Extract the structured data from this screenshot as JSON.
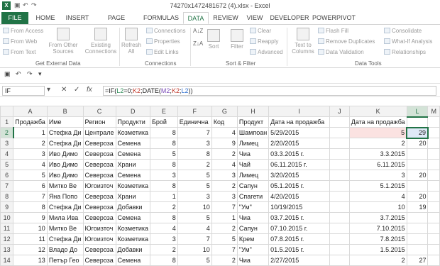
{
  "window": {
    "title": "74270x1472481672 (4).xlsx - Excel",
    "app_icon": "X"
  },
  "tabs": [
    "FILE",
    "HOME",
    "INSERT",
    "PAGE LAYOUT",
    "FORMULAS",
    "DATA",
    "REVIEW",
    "VIEW",
    "DEVELOPER",
    "POWERPIVOT"
  ],
  "ribbon": {
    "get_external": {
      "from_access": "From Access",
      "from_web": "From Web",
      "from_text": "From Text",
      "from_other": "From Other Sources",
      "existing": "Existing Connections",
      "label": "Get External Data"
    },
    "connections": {
      "refresh": "Refresh All",
      "connections": "Connections",
      "properties": "Properties",
      "edit_links": "Edit Links",
      "label": "Connections"
    },
    "sort_filter": {
      "sort": "Sort",
      "filter": "Filter",
      "clear": "Clear",
      "reapply": "Reapply",
      "advanced": "Advanced",
      "label": "Sort & Filter"
    },
    "data_tools": {
      "text_to_columns": "Text to Columns",
      "flash_fill": "Flash Fill",
      "remove_duplicates": "Remove Duplicates",
      "data_validation": "Data Validation",
      "consolidate": "Consolidate",
      "what_if": "What-If Analysis",
      "relationships": "Relationships",
      "label": "Data Tools"
    }
  },
  "namebox": "IF",
  "formula": {
    "p1": "=IF(",
    "r1": "L2",
    "p2": "=0;",
    "r2": "K2",
    "p3": ";DATE(",
    "r3": "M2",
    "p4": ";",
    "r4": "K2",
    "p5": ";",
    "r5": "L2",
    "p6": "))"
  },
  "columns": [
    "A",
    "B",
    "C",
    "D",
    "E",
    "F",
    "G",
    "H",
    "I",
    "J",
    "K",
    "L",
    "M"
  ],
  "rows": [
    [
      "Продажба",
      "Име",
      "Регион",
      "Продукти",
      "Брой",
      "Единична",
      "Код",
      "Продукт",
      "Дата на продажба",
      "",
      "Дата на продажба",
      "",
      ""
    ],
    [
      "1",
      "Стефка Ди",
      "Централе",
      "Козметика",
      "8",
      "7",
      "4",
      "Шампоан",
      "5/29/2015",
      "",
      "5",
      "29",
      ""
    ],
    [
      "2",
      "Стефка Ди",
      "Североза",
      "Семена",
      "8",
      "3",
      "9",
      "Лимец",
      "2/20/2015",
      "",
      "2",
      "20",
      ""
    ],
    [
      "3",
      "Иво Димо",
      "Североза",
      "Семена",
      "5",
      "8",
      "2",
      "Чиа",
      "03.3.2015 г.",
      "",
      "3.3.2015",
      "",
      ""
    ],
    [
      "4",
      "Иво Димо",
      "Североза",
      "Храни",
      "8",
      "2",
      "4",
      "Чай",
      "06.11.2015 г.",
      "",
      "6.11.2015",
      "",
      ""
    ],
    [
      "5",
      "Иво Димо",
      "Североза",
      "Семена",
      "3",
      "5",
      "3",
      "Лимец",
      "3/20/2015",
      "",
      "3",
      "20",
      ""
    ],
    [
      "6",
      "Митко Ве",
      "Югоизточ",
      "Козметика",
      "8",
      "5",
      "2",
      "Сапун",
      "05.1.2015 г.",
      "",
      "5.1.2015",
      "",
      ""
    ],
    [
      "7",
      "Яна Попо",
      "Североза",
      "Храни",
      "1",
      "3",
      "3",
      "Спагети",
      "4/20/2015",
      "",
      "4",
      "20",
      ""
    ],
    [
      "8",
      "Стефка Ди",
      "Североза",
      "Добавки",
      "2",
      "10",
      "7",
      "\"Ум\"",
      "10/19/2015",
      "",
      "10",
      "19",
      ""
    ],
    [
      "9",
      "Мила Ива",
      "Североза",
      "Семена",
      "8",
      "5",
      "1",
      "Чиа",
      "03.7.2015 г.",
      "",
      "3.7.2015",
      "",
      ""
    ],
    [
      "10",
      "Митко Ве",
      "Югоизточ",
      "Козметика",
      "4",
      "4",
      "2",
      "Сапун",
      "07.10.2015 г.",
      "",
      "7.10.2015",
      "",
      ""
    ],
    [
      "11",
      "Стефка Ди",
      "Югоизточ",
      "Козметика",
      "3",
      "7",
      "5",
      "Крем",
      "07.8.2015 г.",
      "",
      "7.8.2015",
      "",
      ""
    ],
    [
      "12",
      "Владо До",
      "Североза",
      "Добавки",
      "2",
      "10",
      "7",
      "\"Ум\"",
      "01.5.2015 г.",
      "",
      "1.5.2015",
      "",
      ""
    ],
    [
      "13",
      "Петър Гео",
      "Североза",
      "Семена",
      "8",
      "5",
      "2",
      "Чиа",
      "2/27/2015",
      "",
      "2",
      "27",
      ""
    ]
  ]
}
